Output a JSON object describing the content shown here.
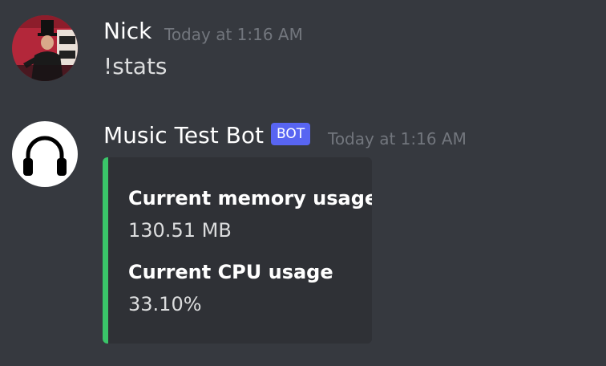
{
  "messages": [
    {
      "author": "Nick",
      "timestamp": "Today at 1:16 AM",
      "content": "!stats"
    },
    {
      "author": "Music Test Bot",
      "badge": "BOT",
      "timestamp": "Today at 1:16 AM",
      "embed": {
        "accent_color": "#3ac569",
        "fields": [
          {
            "name": "Current memory usage",
            "value": "130.51 MB"
          },
          {
            "name": "Current CPU usage",
            "value": "33.10%"
          }
        ]
      }
    }
  ],
  "theme": {
    "background": "#36393f",
    "embed_background": "#2f3136",
    "badge_color": "#5865f2"
  },
  "icons": {
    "user_avatar": "user-avatar",
    "bot_avatar": "headphones-icon"
  }
}
